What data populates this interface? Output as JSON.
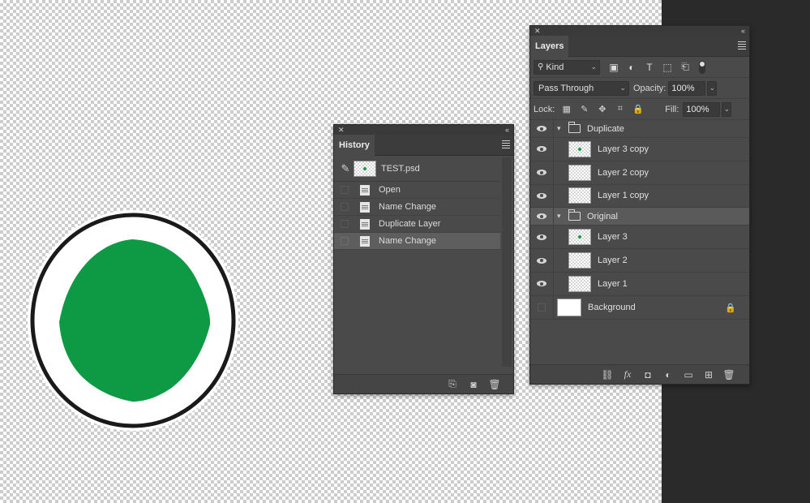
{
  "artwork": {
    "fill_color": "#0e9a44"
  },
  "history": {
    "title": "History",
    "snapshot": {
      "label": "TEST.psd"
    },
    "items": [
      {
        "label": "Open",
        "selected": false
      },
      {
        "label": "Name Change",
        "selected": false
      },
      {
        "label": "Duplicate Layer",
        "selected": false
      },
      {
        "label": "Name Change",
        "selected": true
      }
    ],
    "footer_icons": [
      "new-document-from-state-icon",
      "camera-icon",
      "trash-icon"
    ]
  },
  "layers": {
    "title": "Layers",
    "filter": {
      "label": "Kind"
    },
    "blend_mode": "Pass Through",
    "opacity_label": "Opacity:",
    "opacity": "100%",
    "lock_label": "Lock:",
    "fill_label": "Fill:",
    "fill": "100%",
    "items": [
      {
        "name": "Duplicate",
        "type": "group",
        "expanded": true
      },
      {
        "name": "Layer 3 copy",
        "type": "layer",
        "has_dot": true
      },
      {
        "name": "Layer 2 copy",
        "type": "layer",
        "has_dot": false
      },
      {
        "name": "Layer 1 copy",
        "type": "layer",
        "has_dot": false
      },
      {
        "name": "Original",
        "type": "group",
        "expanded": true,
        "selected": true
      },
      {
        "name": "Layer 3",
        "type": "layer",
        "has_dot": true
      },
      {
        "name": "Layer 2",
        "type": "layer",
        "has_dot": false
      },
      {
        "name": "Layer 1",
        "type": "layer",
        "has_dot": false
      },
      {
        "name": "Background",
        "type": "background",
        "locked": true
      }
    ],
    "footer_icons": [
      "link-icon",
      "fx-icon",
      "mask-icon",
      "adjustment-icon",
      "folder-icon",
      "new-layer-icon",
      "trash-icon"
    ]
  }
}
